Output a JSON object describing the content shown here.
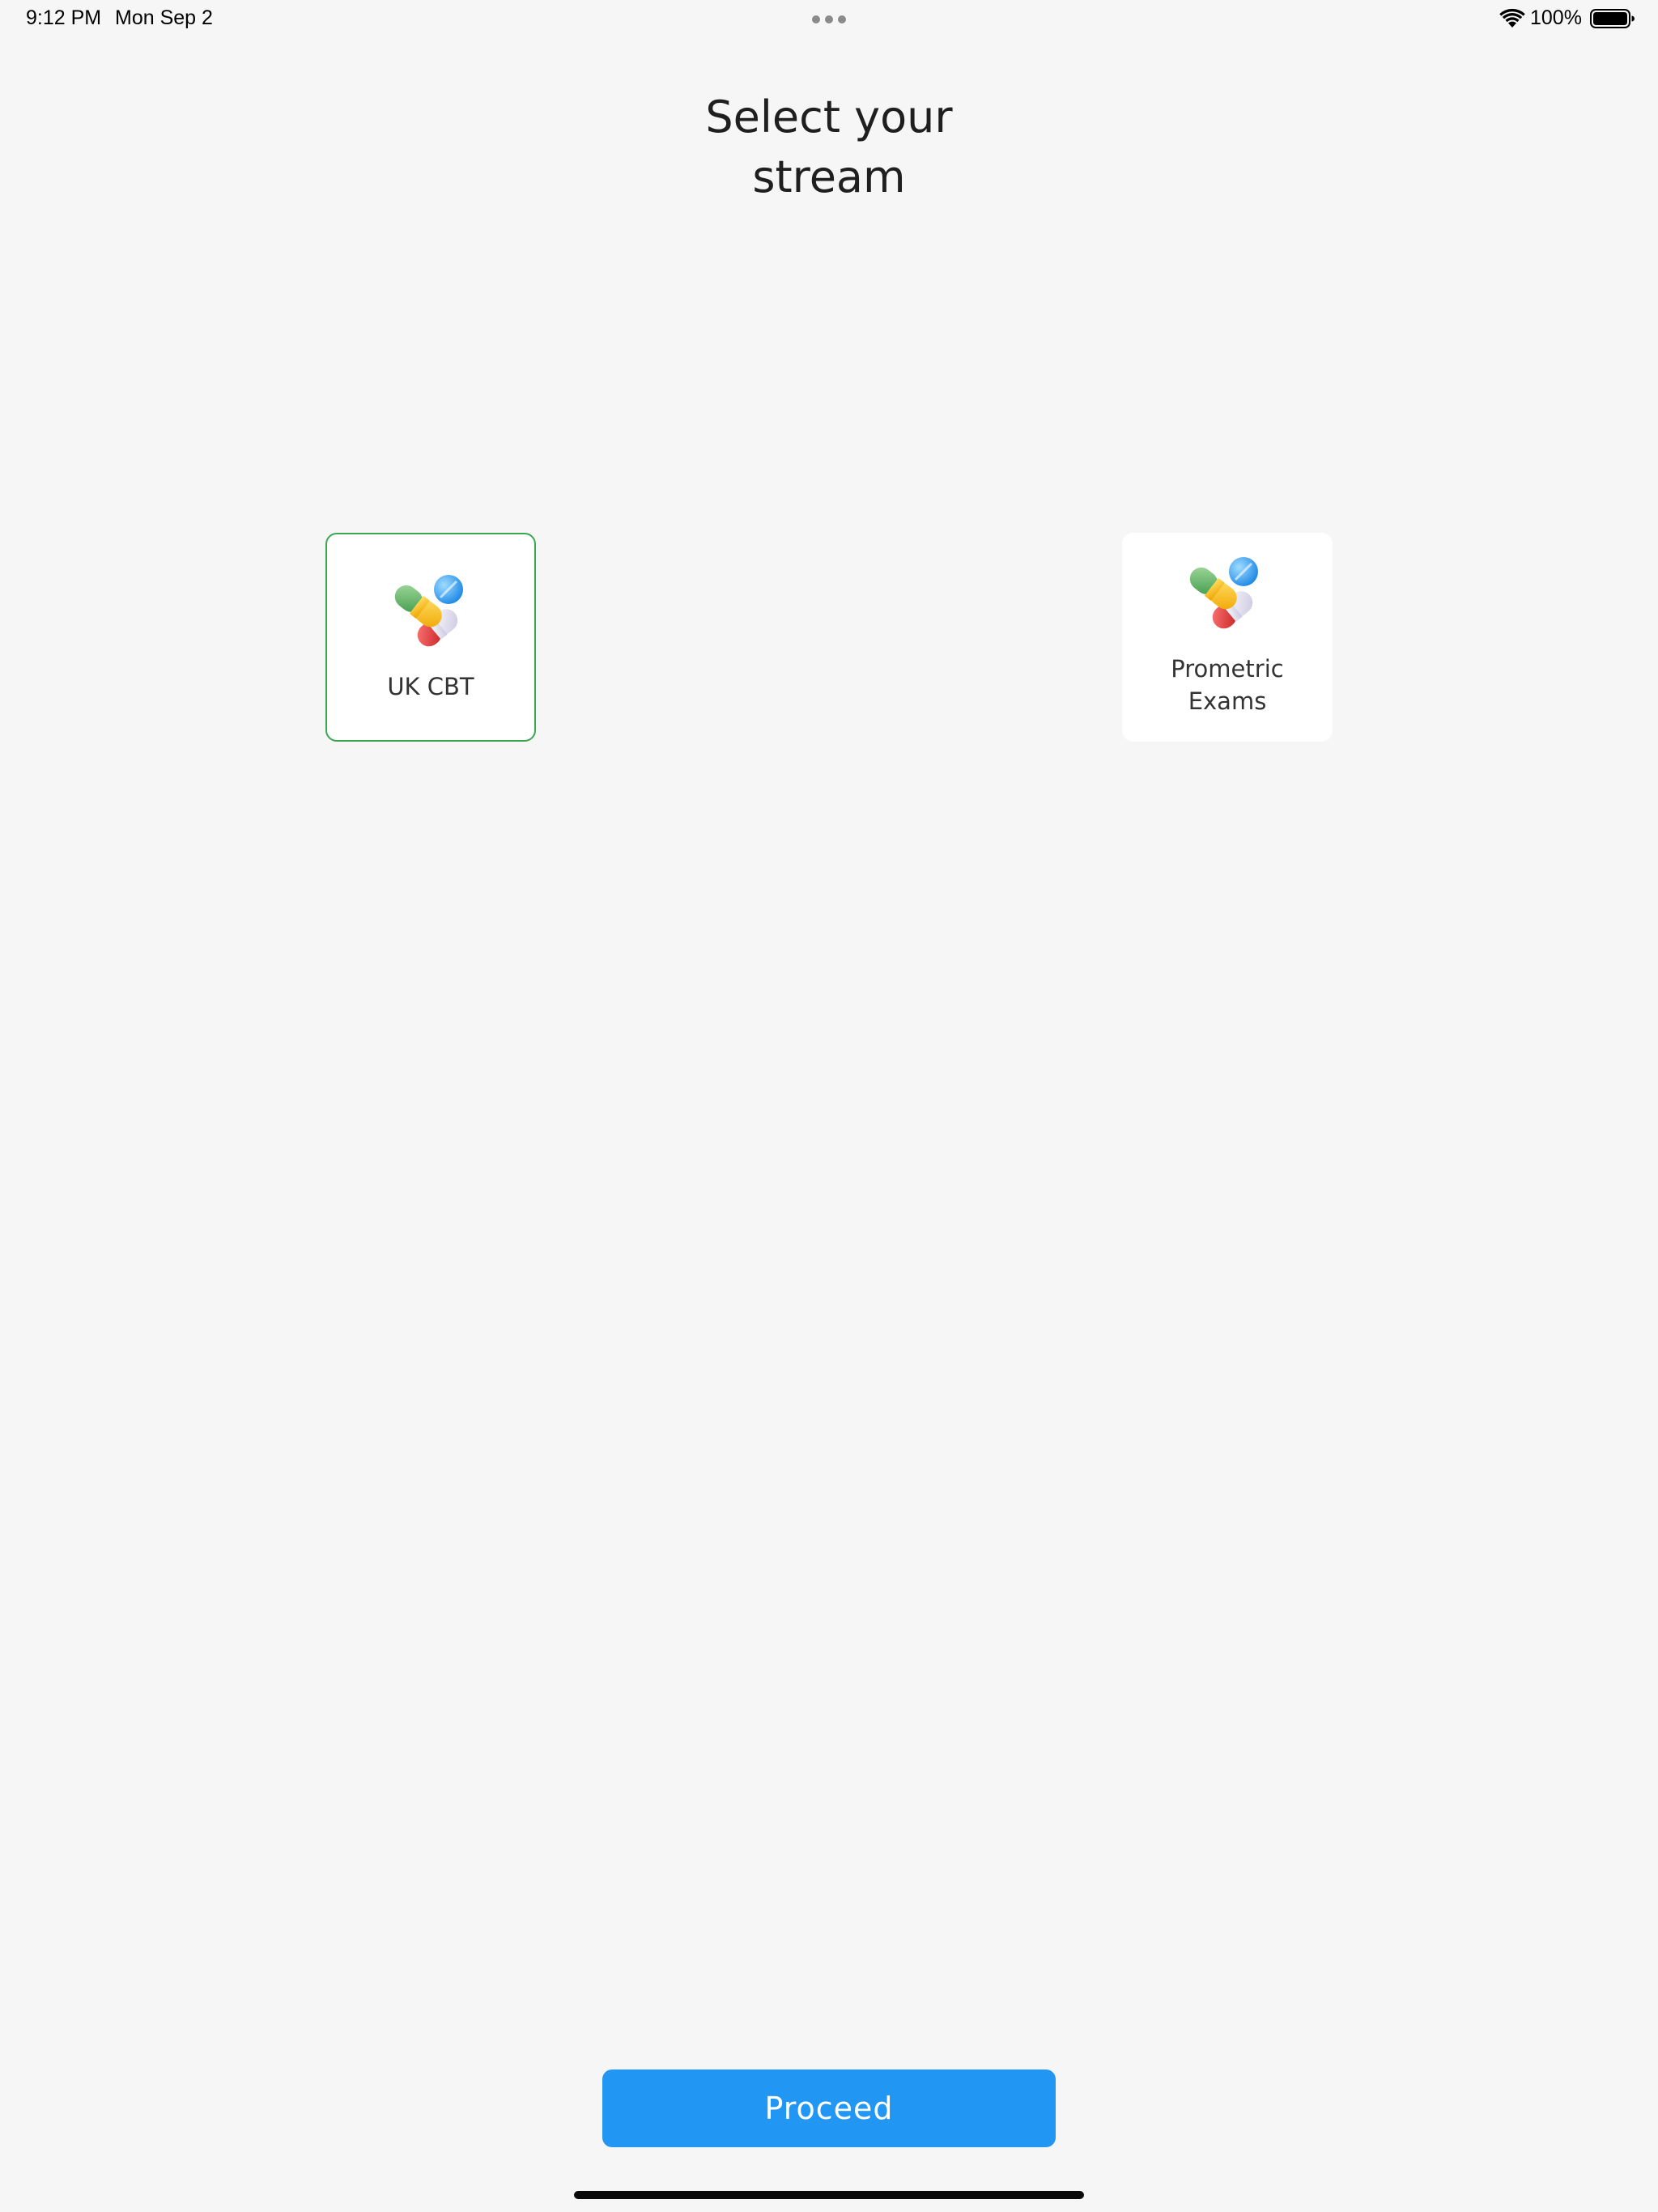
{
  "status_bar": {
    "time": "9:12 PM",
    "date": "Mon Sep 2",
    "battery_percent": "100%",
    "battery_level": 1.0,
    "icons": [
      "multitask-dots-icon",
      "wifi-icon",
      "battery-icon"
    ]
  },
  "header": {
    "title": "Select your\nstream"
  },
  "streams": [
    {
      "label": "UK CBT",
      "selected": true,
      "icon": "pills-icon"
    },
    {
      "label": "Prometric\nExams",
      "selected": false,
      "icon": "pills-icon"
    }
  ],
  "actions": {
    "proceed_label": "Proceed"
  },
  "colors": {
    "background": "#f6f6f6",
    "card_background": "#ffffff",
    "selected_border": "#3ba550",
    "primary_button": "#2196f3",
    "button_text": "#ffffff"
  }
}
